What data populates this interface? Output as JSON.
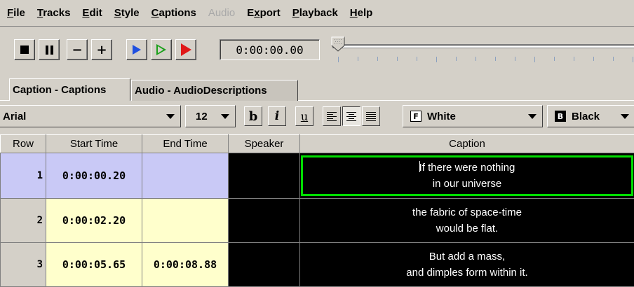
{
  "menu": {
    "items": [
      {
        "label_pre": "",
        "mnemonic": "F",
        "label_post": "ile",
        "enabled": true
      },
      {
        "label_pre": "",
        "mnemonic": "T",
        "label_post": "racks",
        "enabled": true
      },
      {
        "label_pre": "",
        "mnemonic": "E",
        "label_post": "dit",
        "enabled": true
      },
      {
        "label_pre": "",
        "mnemonic": "S",
        "label_post": "tyle",
        "enabled": true
      },
      {
        "label_pre": "",
        "mnemonic": "C",
        "label_post": "aptions",
        "enabled": true
      },
      {
        "label_pre": "",
        "mnemonic": "",
        "label_post": "Audio",
        "enabled": false
      },
      {
        "label_pre": "E",
        "mnemonic": "x",
        "label_post": "port",
        "enabled": true
      },
      {
        "label_pre": "",
        "mnemonic": "P",
        "label_post": "layback",
        "enabled": true
      },
      {
        "label_pre": "",
        "mnemonic": "H",
        "label_post": "elp",
        "enabled": true
      }
    ]
  },
  "toolbar": {
    "minus_label": "−",
    "plus_label": "+",
    "timecode": "0:00:00.00",
    "slider_position": 0
  },
  "tabs": [
    {
      "label": "Caption - Captions",
      "active": true
    },
    {
      "label": "Audio - AudioDescriptions",
      "active": false
    }
  ],
  "format": {
    "font": "Arial",
    "size": "12",
    "bold_label": "b",
    "italic_label": "i",
    "underline_label": "u",
    "fg_icon_letter": "F",
    "fg_color": "White",
    "bg_icon_letter": "B",
    "bg_color": "Black"
  },
  "table": {
    "headers": {
      "row": "Row",
      "start": "Start Time",
      "end": "End Time",
      "speaker": "Speaker",
      "caption": "Caption"
    },
    "rows": [
      {
        "row": "1",
        "start": "0:00:00.20",
        "end": "",
        "speaker": "",
        "line1": "If there were nothing",
        "line2": "in our universe"
      },
      {
        "row": "2",
        "start": "0:00:02.20",
        "end": "",
        "speaker": "",
        "line1": "the fabric of space-time",
        "line2": "would be flat."
      },
      {
        "row": "3",
        "start": "0:00:05.65",
        "end": "0:00:08.88",
        "speaker": "",
        "line1": "But add a mass,",
        "line2": "and dimples form within it."
      }
    ]
  },
  "colors": {
    "selected_row": "#c9c9f6",
    "time_cell": "#ffffcc",
    "caption_bg": "#000000",
    "selection_border": "#00dd00"
  }
}
